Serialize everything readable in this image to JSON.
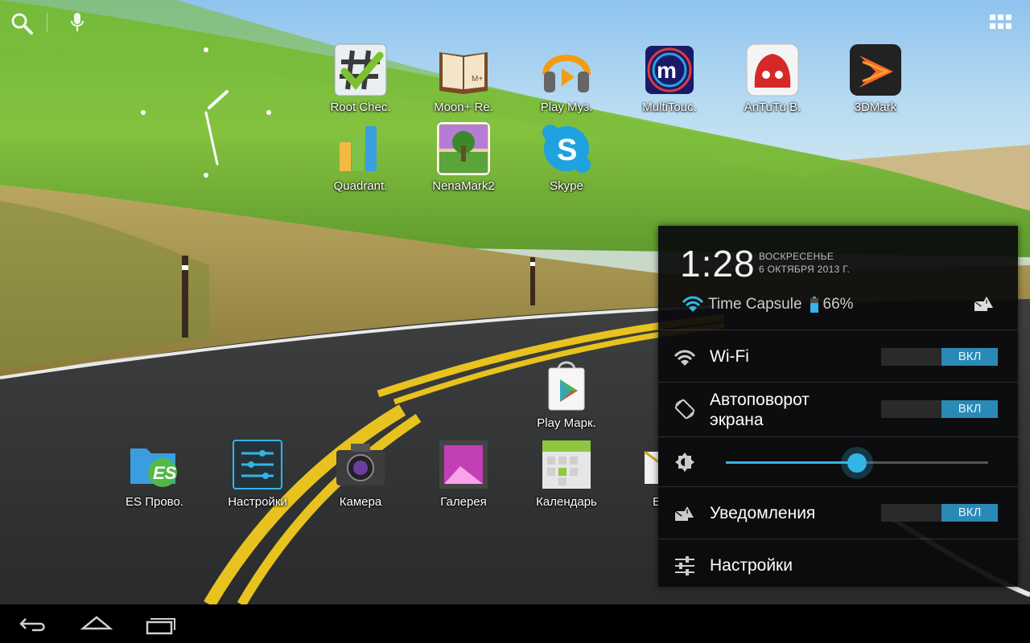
{
  "search_bar": {
    "search_icon": "search-icon",
    "voice_icon": "mic-icon"
  },
  "apps_button": {
    "icon": "all-apps-grid-icon"
  },
  "desktop_apps": [
    {
      "label": "Root Chec.",
      "icon": "root-checker-icon"
    },
    {
      "label": "Moon+ Re.",
      "icon": "moon-reader-icon"
    },
    {
      "label": "Play Муз.",
      "icon": "play-music-icon"
    },
    {
      "label": "MultiTouc.",
      "icon": "multitouch-icon"
    },
    {
      "label": "AnTuTu B.",
      "icon": "antutu-icon"
    },
    {
      "label": "3DMark",
      "icon": "3dmark-icon"
    },
    {
      "label": "Quadrant.",
      "icon": "quadrant-icon"
    },
    {
      "label": "NenaMark2",
      "icon": "nenamark-icon"
    },
    {
      "label": "Skype",
      "icon": "skype-icon"
    },
    {
      "label": "Play Марк.",
      "icon": "play-store-icon"
    }
  ],
  "dock_apps": [
    {
      "label": "ES Прово.",
      "icon": "es-file-explorer-icon"
    },
    {
      "label": "Настройки",
      "icon": "settings-icon"
    },
    {
      "label": "Камера",
      "icon": "camera-icon"
    },
    {
      "label": "Галерея",
      "icon": "gallery-icon"
    },
    {
      "label": "Календарь",
      "icon": "calendar-icon"
    },
    {
      "label": "E",
      "icon": "email-icon"
    }
  ],
  "quick_settings": {
    "time": "1:28",
    "day": "ВОСКРЕСЕНЬЕ",
    "date": "6 ОКТЯБРЯ 2013 Г.",
    "network_name": "Time Capsule",
    "battery_percent": "66%",
    "battery_level": 0.66,
    "rows": {
      "wifi": {
        "label": "Wi-Fi",
        "state": "ВКЛ"
      },
      "rotation": {
        "label_line1": "Автоповорот",
        "label_line2": "экрана",
        "state": "ВКЛ"
      },
      "brightness": {
        "level": 0.5
      },
      "notifications": {
        "label": "Уведомления",
        "state": "ВКЛ"
      },
      "settings": {
        "label": "Настройки"
      }
    }
  },
  "navbar": {
    "back": "back-icon",
    "home": "home-icon",
    "recents": "recent-apps-icon"
  },
  "colors": {
    "accent": "#33b5e5",
    "toggle_on": "#2a8ab6",
    "panel_bg": "#0a0a0c"
  }
}
